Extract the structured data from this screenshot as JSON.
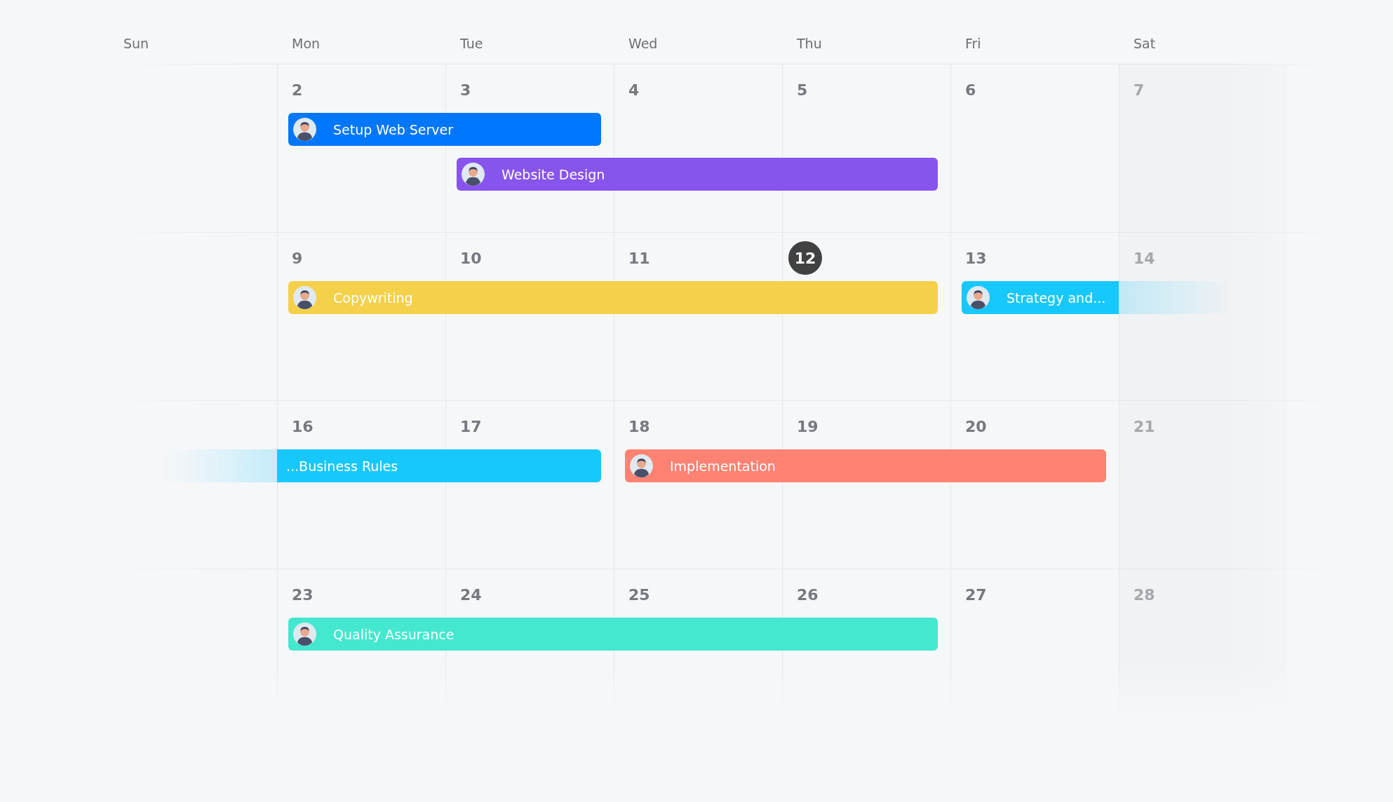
{
  "weekdays": [
    "Sun",
    "Mon",
    "Tue",
    "Wed",
    "Thu",
    "Fri",
    "Sat"
  ],
  "weeks": [
    {
      "days": [
        {
          "date": "2",
          "today": false,
          "dimmed": false
        },
        {
          "date": "3",
          "today": false,
          "dimmed": false
        },
        {
          "date": "4",
          "today": false,
          "dimmed": false
        },
        {
          "date": "5",
          "today": false,
          "dimmed": false
        },
        {
          "date": "6",
          "today": false,
          "dimmed": false
        },
        {
          "date": "7",
          "today": false,
          "dimmed": true
        }
      ],
      "events": [
        {
          "title": "Setup Web Server",
          "color": "#0077ff",
          "avatar": true,
          "continues_before": false,
          "continues_after": false
        },
        {
          "title": "Website Design",
          "color": "#8854ee",
          "avatar": true,
          "continues_before": false,
          "continues_after": false
        }
      ]
    },
    {
      "days": [
        {
          "date": "9",
          "today": false,
          "dimmed": false
        },
        {
          "date": "10",
          "today": false,
          "dimmed": false
        },
        {
          "date": "11",
          "today": false,
          "dimmed": false
        },
        {
          "date": "12",
          "today": true,
          "dimmed": false
        },
        {
          "date": "13",
          "today": false,
          "dimmed": false
        },
        {
          "date": "14",
          "today": false,
          "dimmed": true
        }
      ],
      "events": [
        {
          "title": "Copywriting",
          "color": "#f5d04b",
          "avatar": true,
          "continues_before": false,
          "continues_after": false
        },
        {
          "title": "Strategy and...",
          "color": "#17c8ff",
          "avatar": true,
          "continues_before": false,
          "continues_after": true
        }
      ]
    },
    {
      "days": [
        {
          "date": "16",
          "today": false,
          "dimmed": false
        },
        {
          "date": "17",
          "today": false,
          "dimmed": false
        },
        {
          "date": "18",
          "today": false,
          "dimmed": false
        },
        {
          "date": "19",
          "today": false,
          "dimmed": false
        },
        {
          "date": "20",
          "today": false,
          "dimmed": false
        },
        {
          "date": "21",
          "today": false,
          "dimmed": true
        }
      ],
      "events": [
        {
          "title": "...Business Rules",
          "color": "#17c8ff",
          "avatar": false,
          "continues_before": true,
          "continues_after": false
        },
        {
          "title": "Implementation",
          "color": "#ff8272",
          "avatar": true,
          "continues_before": false,
          "continues_after": false
        }
      ]
    },
    {
      "days": [
        {
          "date": "23",
          "today": false,
          "dimmed": false
        },
        {
          "date": "24",
          "today": false,
          "dimmed": false
        },
        {
          "date": "25",
          "today": false,
          "dimmed": false
        },
        {
          "date": "26",
          "today": false,
          "dimmed": false
        },
        {
          "date": "27",
          "today": false,
          "dimmed": false
        },
        {
          "date": "28",
          "today": false,
          "dimmed": true
        }
      ],
      "events": [
        {
          "title": "Quality Assurance",
          "color": "#44e8ce",
          "avatar": true,
          "continues_before": false,
          "continues_after": false
        }
      ]
    }
  ]
}
